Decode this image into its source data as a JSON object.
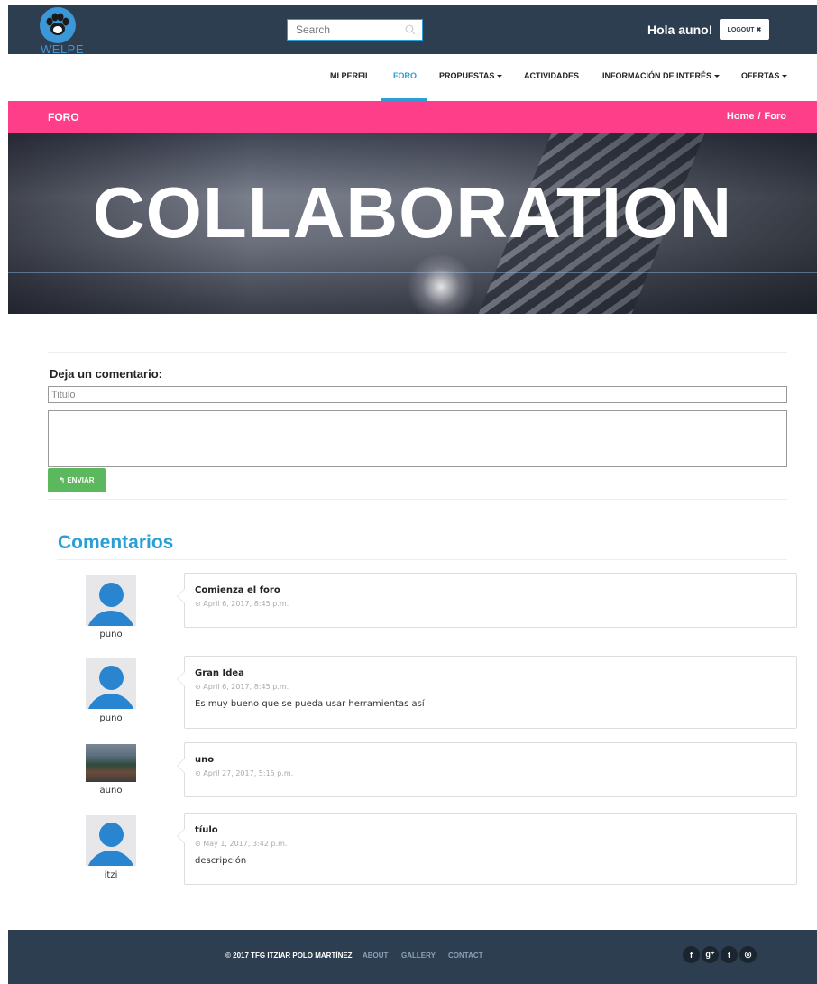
{
  "header": {
    "logo_text": "WELPE",
    "search_placeholder": "Search",
    "greeting": "Hola auno!",
    "logout_label": "LOGOUT ✖"
  },
  "nav": {
    "items": [
      {
        "label": "MI PERFIL"
      },
      {
        "label": "FORO"
      },
      {
        "label": "PROPUESTAS"
      },
      {
        "label": "ACTIVIDADES"
      },
      {
        "label": "INFORMACIÓN DE INTERÉS"
      },
      {
        "label": "OFERTAS"
      }
    ],
    "active": "FORO"
  },
  "page_header": {
    "title": "FORO",
    "breadcrumb": [
      "Home",
      "Foro"
    ],
    "breadcrumb_separator": "/"
  },
  "hero": {
    "text": "COLLABORATION"
  },
  "form": {
    "label": "Deja un comentario:",
    "title_placeholder": "Titulo",
    "submit_label": "↰ ENVIAR"
  },
  "comments": {
    "heading": "Comentarios",
    "items": [
      {
        "user": "puno",
        "title": "Comienza el foro",
        "date": "⊙ April 6, 2017, 8:45 p.m.",
        "body": "",
        "avatar": "default"
      },
      {
        "user": "puno",
        "title": "Gran Idea",
        "date": "⊙ April 6, 2017, 8:45 p.m.",
        "body": "Es muy bueno que se pueda usar herramientas así",
        "avatar": "default"
      },
      {
        "user": "auno",
        "title": "uno",
        "date": "⊙ April 27, 2017, 5:15 p.m.",
        "body": "",
        "avatar": "photo"
      },
      {
        "user": "itzi",
        "title": "tíulo",
        "date": "⊙ May 1, 2017, 3:42 p.m.",
        "body": "descripción",
        "avatar": "default"
      }
    ]
  },
  "footer": {
    "copyright": "© 2017 TFG ITZIAR POLO MARTÍNEZ",
    "links": [
      "ABOUT",
      "GALLERY",
      "CONTACT"
    ],
    "social": [
      {
        "icon": "facebook-icon",
        "glyph": "f"
      },
      {
        "icon": "google-plus-icon",
        "glyph": "g⁺"
      },
      {
        "icon": "twitter-icon",
        "glyph": "t"
      },
      {
        "icon": "dribbble-icon",
        "glyph": "◎"
      }
    ]
  },
  "colors": {
    "navbar": "#2c3e50",
    "accent_blue": "#2a9fd6",
    "pink": "#ff3e8a",
    "green": "#5cb85c"
  }
}
